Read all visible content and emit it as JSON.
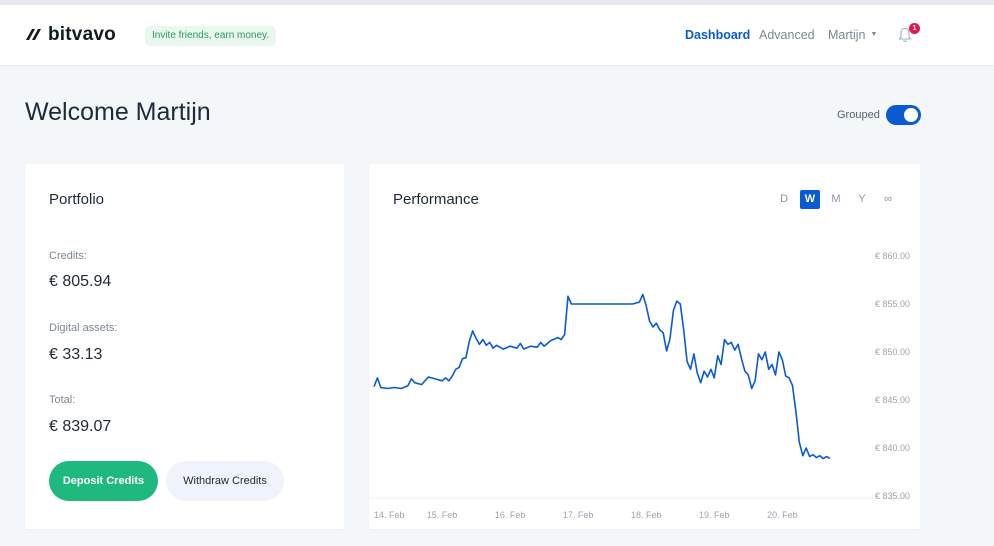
{
  "header": {
    "logo_text": "bitvavo",
    "invite_text": "Invite friends, earn money.",
    "nav": {
      "dashboard": "Dashboard",
      "advanced": "Advanced",
      "user": "Martijn"
    },
    "notification_count": "1"
  },
  "page": {
    "welcome": "Welcome Martijn",
    "grouped_label": "Grouped",
    "grouped_on": true
  },
  "portfolio": {
    "title": "Portfolio",
    "credits_label": "Credits:",
    "credits_value": "€ 805.94",
    "assets_label": "Digital assets:",
    "assets_value": "€ 33.13",
    "total_label": "Total:",
    "total_value": "€ 839.07",
    "deposit_label": "Deposit Credits",
    "withdraw_label": "Withdraw Credits"
  },
  "performance": {
    "title": "Performance",
    "ranges": [
      "D",
      "W",
      "M",
      "Y",
      "∞"
    ],
    "active_range": "W"
  },
  "colors": {
    "accent": "#0a5ad1",
    "deposit": "#1fb87f",
    "line": "#0a5ad1",
    "badge": "#e5174b"
  },
  "chart_data": {
    "type": "line",
    "title": "",
    "xlabel": "",
    "ylabel": "",
    "x_tick_labels": [
      "14. Feb",
      "15. Feb",
      "16. Feb",
      "17. Feb",
      "18. Feb",
      "19. Feb",
      "20. Feb"
    ],
    "y_tick_labels": [
      "€ 860.00",
      "€ 855.00",
      "€ 850.00",
      "€ 845.00",
      "€ 840.00",
      "€ 835.00"
    ],
    "y_ticks": [
      860,
      855,
      850,
      845,
      840,
      835
    ],
    "ylim": [
      835,
      860
    ],
    "xlim": [
      0,
      7.2
    ],
    "grid": false,
    "series": [
      {
        "values": [
          [
            0.0,
            846.4
          ],
          [
            0.05,
            847.3
          ],
          [
            0.1,
            846.3
          ],
          [
            0.2,
            846.2
          ],
          [
            0.3,
            846.3
          ],
          [
            0.4,
            846.2
          ],
          [
            0.5,
            846.5
          ],
          [
            0.55,
            847.2
          ],
          [
            0.6,
            846.8
          ],
          [
            0.7,
            846.6
          ],
          [
            0.8,
            847.4
          ],
          [
            0.9,
            847.2
          ],
          [
            1.0,
            847.0
          ],
          [
            1.05,
            847.3
          ],
          [
            1.1,
            847.0
          ],
          [
            1.15,
            847.5
          ],
          [
            1.2,
            848.2
          ],
          [
            1.25,
            848.4
          ],
          [
            1.3,
            849.3
          ],
          [
            1.35,
            849.4
          ],
          [
            1.4,
            851.1
          ],
          [
            1.45,
            852.2
          ],
          [
            1.5,
            851.4
          ],
          [
            1.55,
            850.8
          ],
          [
            1.6,
            851.3
          ],
          [
            1.65,
            850.7
          ],
          [
            1.7,
            851.0
          ],
          [
            1.75,
            850.4
          ],
          [
            1.8,
            850.7
          ],
          [
            1.9,
            850.3
          ],
          [
            2.0,
            850.6
          ],
          [
            2.1,
            850.4
          ],
          [
            2.15,
            850.9
          ],
          [
            2.2,
            850.3
          ],
          [
            2.3,
            850.6
          ],
          [
            2.4,
            850.5
          ],
          [
            2.45,
            851.0
          ],
          [
            2.5,
            850.6
          ],
          [
            2.6,
            851.2
          ],
          [
            2.7,
            851.5
          ],
          [
            2.75,
            851.3
          ],
          [
            2.8,
            851.8
          ],
          [
            2.85,
            855.8
          ],
          [
            2.9,
            855.0
          ],
          [
            3.0,
            855.0
          ],
          [
            3.2,
            855.0
          ],
          [
            3.4,
            855.0
          ],
          [
            3.6,
            855.0
          ],
          [
            3.8,
            855.0
          ],
          [
            3.9,
            855.2
          ],
          [
            3.95,
            856.0
          ],
          [
            4.0,
            854.8
          ],
          [
            4.05,
            853.2
          ],
          [
            4.1,
            852.6
          ],
          [
            4.15,
            853.0
          ],
          [
            4.2,
            852.3
          ],
          [
            4.25,
            852.0
          ],
          [
            4.3,
            850.1
          ],
          [
            4.35,
            851.4
          ],
          [
            4.4,
            854.3
          ],
          [
            4.45,
            855.3
          ],
          [
            4.5,
            855.0
          ],
          [
            4.55,
            852.3
          ],
          [
            4.6,
            849.0
          ],
          [
            4.65,
            848.2
          ],
          [
            4.7,
            849.8
          ],
          [
            4.75,
            847.8
          ],
          [
            4.8,
            846.8
          ],
          [
            4.85,
            848.0
          ],
          [
            4.9,
            847.4
          ],
          [
            4.95,
            848.2
          ],
          [
            5.0,
            847.3
          ],
          [
            5.05,
            849.6
          ],
          [
            5.1,
            848.7
          ],
          [
            5.15,
            851.3
          ],
          [
            5.2,
            850.8
          ],
          [
            5.25,
            851.0
          ],
          [
            5.3,
            850.2
          ],
          [
            5.35,
            850.8
          ],
          [
            5.4,
            849.3
          ],
          [
            5.45,
            848.0
          ],
          [
            5.5,
            847.6
          ],
          [
            5.55,
            846.2
          ],
          [
            5.6,
            847.0
          ],
          [
            5.65,
            849.8
          ],
          [
            5.7,
            849.2
          ],
          [
            5.75,
            850.0
          ],
          [
            5.8,
            848.2
          ],
          [
            5.85,
            848.7
          ],
          [
            5.9,
            847.6
          ],
          [
            5.95,
            850.0
          ],
          [
            6.0,
            849.2
          ],
          [
            6.05,
            847.5
          ],
          [
            6.1,
            847.3
          ],
          [
            6.15,
            846.5
          ],
          [
            6.2,
            843.8
          ],
          [
            6.25,
            840.6
          ],
          [
            6.3,
            839.2
          ],
          [
            6.35,
            840.0
          ],
          [
            6.4,
            839.1
          ],
          [
            6.45,
            839.3
          ],
          [
            6.5,
            839.0
          ],
          [
            6.55,
            839.2
          ],
          [
            6.6,
            838.9
          ],
          [
            6.65,
            839.1
          ],
          [
            6.7,
            838.9
          ]
        ]
      }
    ]
  }
}
